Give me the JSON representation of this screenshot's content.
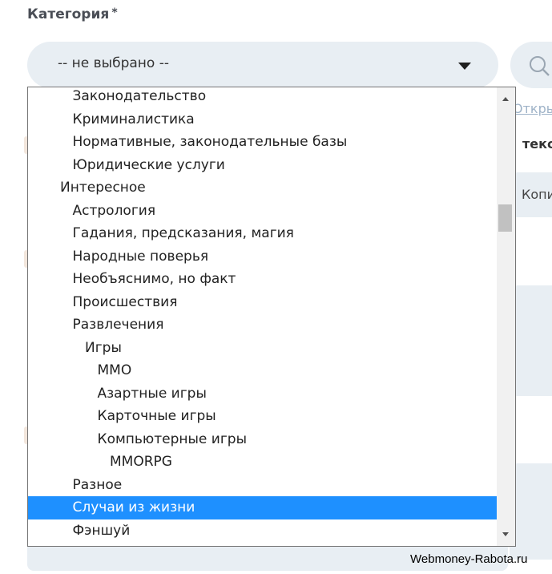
{
  "field": {
    "label": "Категория",
    "required_mark": "*"
  },
  "select": {
    "value": "-- не выбрано --"
  },
  "background": {
    "link_text": "Откры",
    "bold_text": "текс",
    "box_text": "Копи"
  },
  "options": [
    {
      "label": "Законодательство",
      "level": 1,
      "selected": false
    },
    {
      "label": "Криминалистика",
      "level": 1,
      "selected": false
    },
    {
      "label": "Нормативные, законодательные базы",
      "level": 1,
      "selected": false
    },
    {
      "label": "Юридические услуги",
      "level": 1,
      "selected": false
    },
    {
      "label": "Интересное",
      "level": 0,
      "selected": false
    },
    {
      "label": "Астрология",
      "level": 1,
      "selected": false
    },
    {
      "label": "Гадания, предсказания, магия",
      "level": 1,
      "selected": false
    },
    {
      "label": "Народные поверья",
      "level": 1,
      "selected": false
    },
    {
      "label": "Необъяснимо, но факт",
      "level": 1,
      "selected": false
    },
    {
      "label": "Происшествия",
      "level": 1,
      "selected": false
    },
    {
      "label": "Развлечения",
      "level": 1,
      "selected": false
    },
    {
      "label": "Игры",
      "level": 2,
      "selected": false
    },
    {
      "label": "MMO",
      "level": 3,
      "selected": false
    },
    {
      "label": "Азартные игры",
      "level": 3,
      "selected": false
    },
    {
      "label": "Карточные игры",
      "level": 3,
      "selected": false
    },
    {
      "label": "Компьютерные игры",
      "level": 3,
      "selected": false
    },
    {
      "label": "MMORPG",
      "level": 4,
      "selected": false
    },
    {
      "label": "Разное",
      "level": 1,
      "selected": false
    },
    {
      "label": "Случаи из жизни",
      "level": 1,
      "selected": true
    },
    {
      "label": "Фэншуй",
      "level": 1,
      "selected": false
    }
  ],
  "scroll_position": 0.25,
  "watermark": "Webmoney-Rabota.ru",
  "colors": {
    "highlight": "#1e90ff",
    "field_bg": "#e8eef3"
  },
  "icons": {
    "select_arrow": "caret-down-icon",
    "search": "search-icon",
    "scroll_up": "scroll-up-arrow-icon",
    "scroll_down": "scroll-down-arrow-icon"
  }
}
